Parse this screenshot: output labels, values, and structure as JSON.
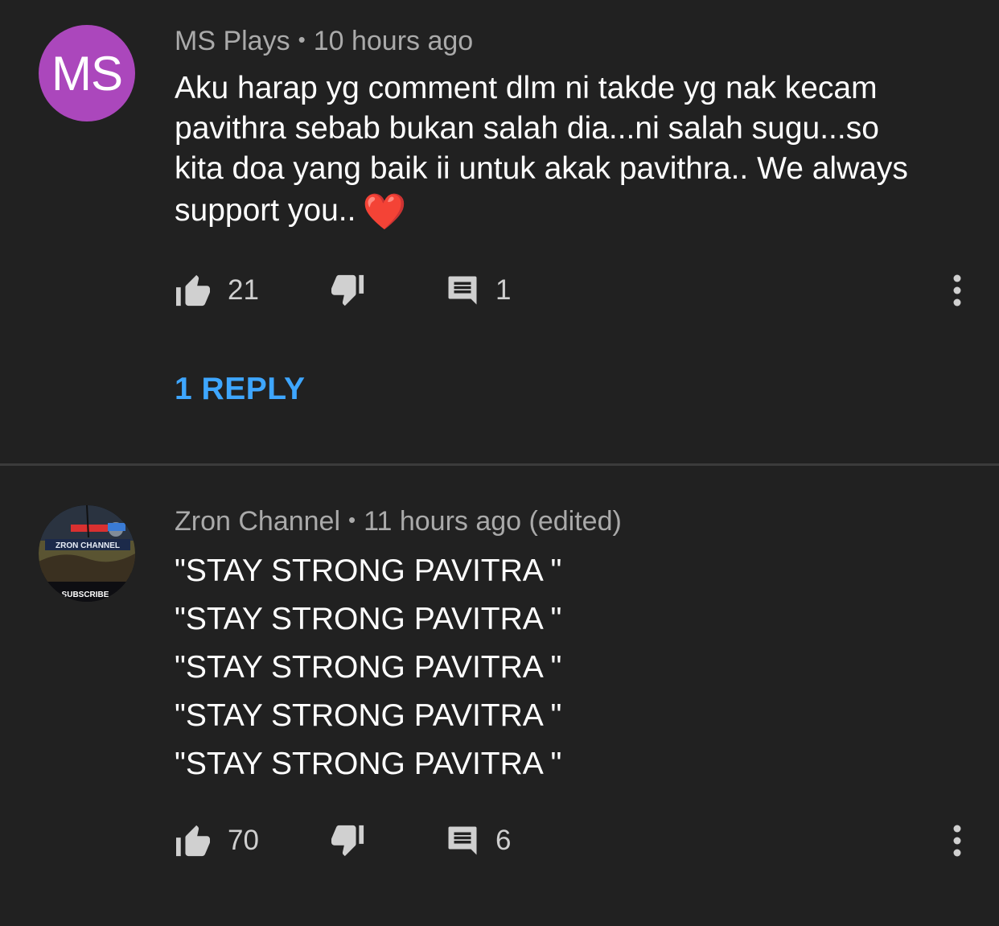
{
  "comments": [
    {
      "avatar_initials": "MS",
      "avatar_color": "#ab47bc",
      "author": "MS Plays",
      "time": "10 hours ago",
      "text_lines": [
        "Aku harap yg comment dlm ni takde yg nak kecam",
        "pavithra sebab bukan salah dia...ni salah sugu...so",
        "kita doa yang baik ii untuk akak pavithra.. We always",
        "support you.."
      ],
      "emoji": "❤️",
      "likes": "21",
      "replies_count": "1",
      "replies_link": "1 REPLY"
    },
    {
      "avatar_text_1": "ZRON CHANNEL",
      "avatar_text_2": "SUBSCRIBE",
      "author": "Zron Channel",
      "time": "11 hours ago (edited)",
      "text_lines": [
        "\"STAY STRONG PAVITRA \"",
        "\"STAY STRONG PAVITRA \"",
        "\"STAY STRONG PAVITRA \"",
        "\"STAY STRONG PAVITRA \"",
        "\"STAY STRONG PAVITRA \""
      ],
      "likes": "70",
      "replies_count": "6"
    }
  ],
  "icons": {
    "like": "thumb-up-icon",
    "dislike": "thumb-down-icon",
    "reply": "comment-icon",
    "more": "more-vert-icon"
  },
  "colors": {
    "background": "#212121",
    "meta": "#aaaaaa",
    "link": "#3ea6ff"
  }
}
